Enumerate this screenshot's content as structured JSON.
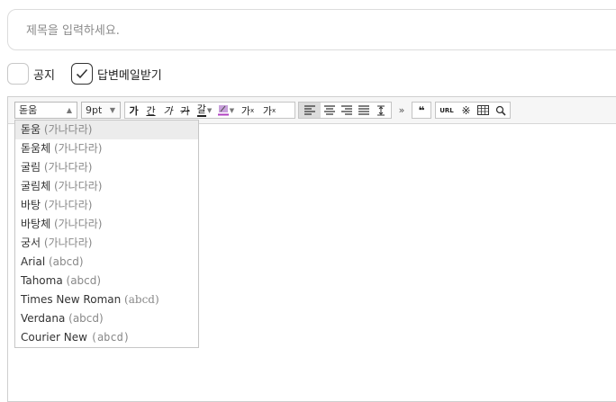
{
  "title_field": {
    "placeholder": "제목을 입력하세요."
  },
  "options": [
    {
      "label": "공지",
      "checked": false
    },
    {
      "label": "답변메일받기",
      "checked": true
    }
  ],
  "toolbar": {
    "font_select": "돋움",
    "size_select": "9pt",
    "buttons": {
      "bold": "가",
      "underline": "간",
      "italic": "가",
      "strike": "가",
      "font_color": "갈",
      "sup": "가",
      "sub": "가",
      "quote": "❝",
      "url": "URL",
      "more": "»"
    }
  },
  "font_menu": {
    "items": [
      {
        "name": "돋움",
        "sample": "(가나다라)"
      },
      {
        "name": "돋움체",
        "sample": "(가나다라)"
      },
      {
        "name": "굴림",
        "sample": "(가나다라)"
      },
      {
        "name": "굴림체",
        "sample": "(가나다라)"
      },
      {
        "name": "바탕",
        "sample": "(가나다라)"
      },
      {
        "name": "바탕체",
        "sample": "(가나다라)"
      },
      {
        "name": "궁서",
        "sample": "(가나다라)"
      },
      {
        "name": "Arial",
        "sample": "(abcd)"
      },
      {
        "name": "Tahoma",
        "sample": "(abcd)"
      },
      {
        "name": "Times New Roman",
        "sample": "(abcd)"
      },
      {
        "name": "Verdana",
        "sample": "(abcd)"
      },
      {
        "name": "Courier New",
        "sample": "(abcd)"
      }
    ]
  },
  "colors": {
    "border": "#dcdcdc",
    "toolbar_bg": "#f6f6f6",
    "highlight": "#ececec"
  }
}
